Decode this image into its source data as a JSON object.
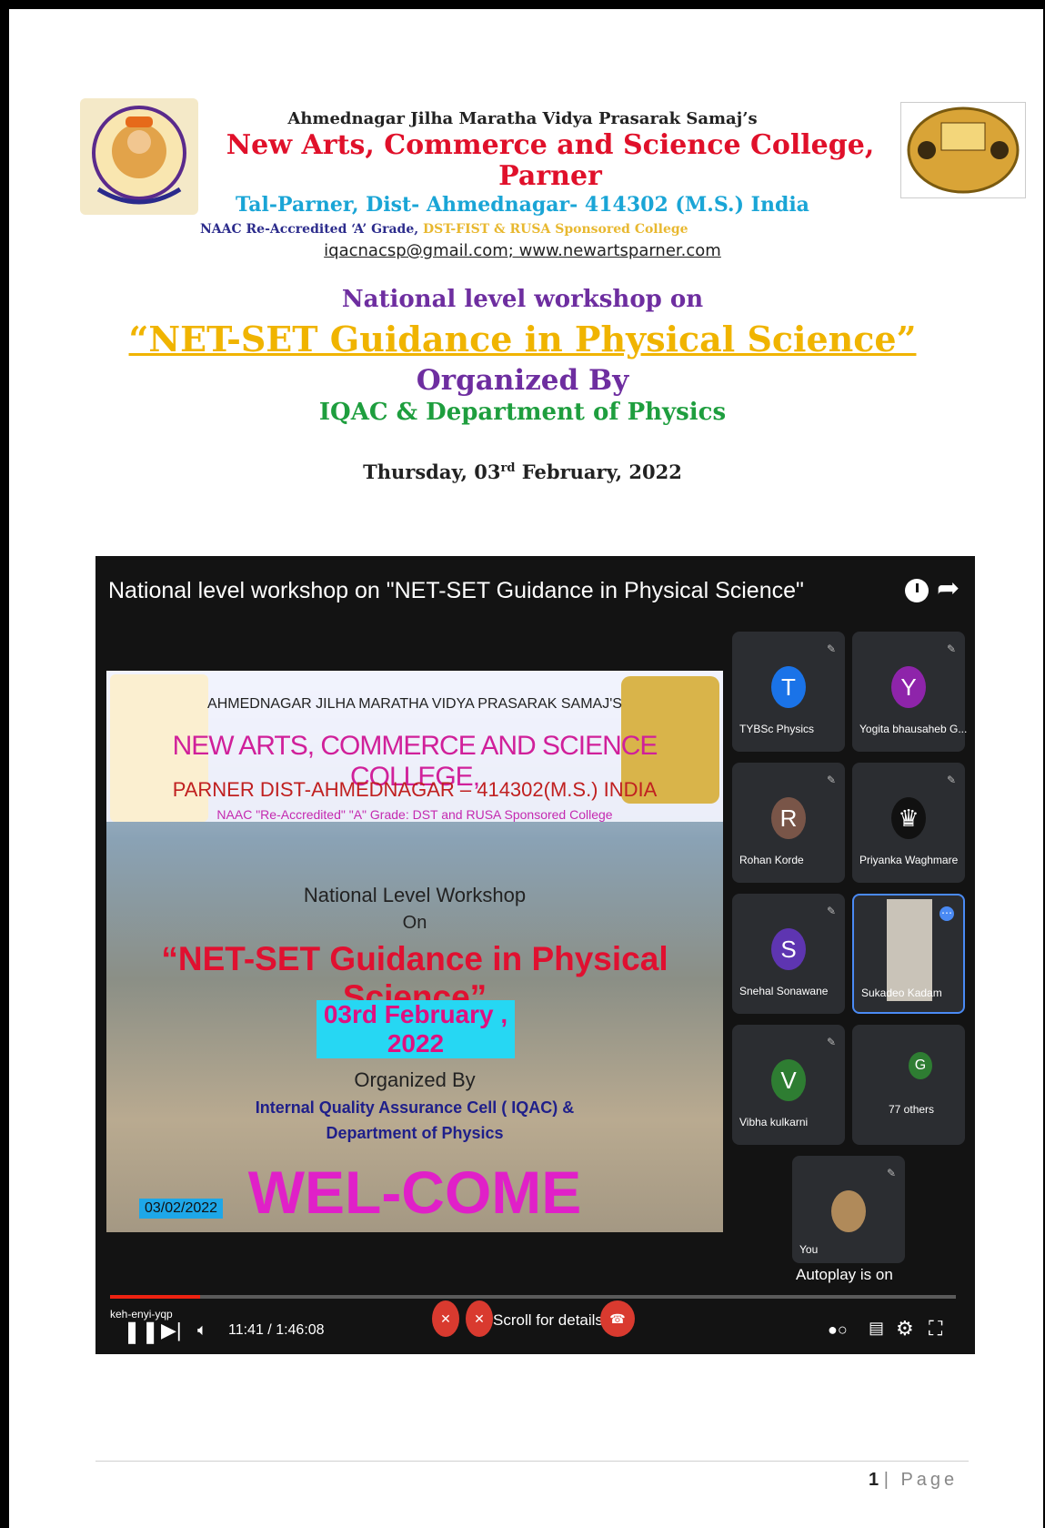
{
  "header": {
    "society": "Ahmednagar Jilha Maratha Vidya Prasarak Samaj’s",
    "college": "New Arts, Commerce and Science College, Parner",
    "address": "Tal-Parner, Dist- Ahmednagar- 414302 (M.S.) India",
    "accreditation_a": "NAAC Re-Accredited ‘A’ Grade, ",
    "accreditation_b": "DST-FIST & RUSA Sponsored College",
    "contact": "iqacnacsp@gmail.com; www.newartsparner.com"
  },
  "workshop": {
    "line1": "National level workshop on",
    "title": "“NET-SET Guidance in Physical Science”",
    "organized_by": "Organized By",
    "organizer": "IQAC & Department of Physics",
    "date_day": "Thursday, 03",
    "date_sup": "rd",
    "date_rest": " February, 2022"
  },
  "video": {
    "title": "National level workshop on \"NET-SET Guidance in Physical Science\"",
    "time": "11:41 / 1:46:08",
    "autoplay": "Autoplay is on",
    "scroll_hint": "Scroll for details",
    "code": "keh-enyi-yqp",
    "progress_fraction": 0.106
  },
  "slide": {
    "society": "AHMEDNAGAR JILHA MARATHA VIDYA PRASARAK SAMAJ'S",
    "college": "NEW ARTS, COMMERCE AND SCIENCE COLLEGE,",
    "place": "PARNER DIST-AHMEDNAGAR – 414302(M.S.) INDIA",
    "naac": "NAAC \"Re-Accredited\" \"A\" Grade: DST and RUSA Sponsored College",
    "level": "National Level Workshop",
    "on": "On",
    "title": "“NET-SET Guidance in Physical Science”",
    "date": "03rd February , 2022",
    "organized": "Organized By",
    "cell": "Internal Quality Assurance Cell ( IQAC) &",
    "dept": "Department of Physics",
    "welcome": "WEL-COME",
    "stamp": "03/02/2022"
  },
  "participants": [
    {
      "initial": "T",
      "name": "TYBSc Physics",
      "color": "#1a73e8"
    },
    {
      "initial": "Y",
      "name": "Yogita bhausaheb G...",
      "color": "#8e24aa"
    },
    {
      "initial": "R",
      "name": "Rohan Korde",
      "color": "#795548"
    },
    {
      "initial": "",
      "name": "Priyanka Waghmare",
      "color": "#111111"
    },
    {
      "initial": "S",
      "name": "Snehal Sonawane",
      "color": "#5e35b1"
    },
    {
      "initial": "",
      "name": "Sukadeo Kadam",
      "color": "#c9c3b8"
    },
    {
      "initial": "V",
      "name": "Vibha kulkarni",
      "color": "#2e7d32"
    },
    {
      "initial": "G",
      "name": "77 others",
      "color": "#2e7d32"
    },
    {
      "initial": "",
      "name": "You",
      "color": "#b08a5a"
    }
  ],
  "footer": {
    "page_number": "1",
    "page_label": "| Page"
  }
}
